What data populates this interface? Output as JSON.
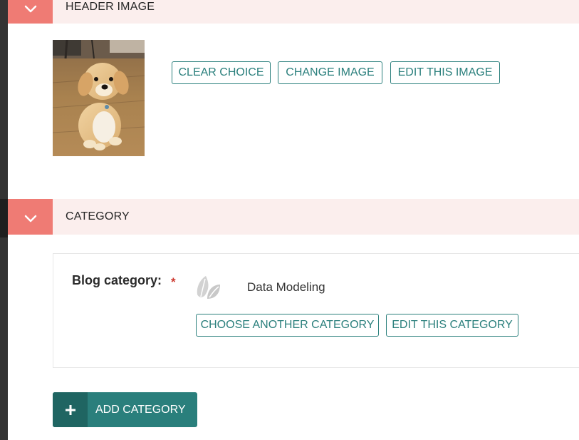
{
  "header_image_panel": {
    "title": "HEADER IMAGE",
    "toggle_icon": "chevron-down-icon",
    "image_alt": "golden retriever puppy photo",
    "buttons": {
      "clear": "CLEAR CHOICE",
      "change": "CHANGE IMAGE",
      "edit": "EDIT THIS IMAGE"
    }
  },
  "category_panel": {
    "title": "CATEGORY",
    "toggle_icon": "chevron-down-icon",
    "field_label": "Blog category:",
    "required_mark": "*",
    "category_icon": "leaf-icon",
    "selected_category": "Data Modeling",
    "buttons": {
      "choose_another": "CHOOSE ANOTHER CATEGORY",
      "edit": "EDIT THIS CATEGORY"
    },
    "add_button": {
      "icon": "plus-icon",
      "label": "ADD CATEGORY"
    }
  },
  "colors": {
    "accent_teal": "#2a7f7c",
    "header_bg": "#fbeeed",
    "toggle_bg": "#ef7b74",
    "required": "#cd3a30"
  }
}
